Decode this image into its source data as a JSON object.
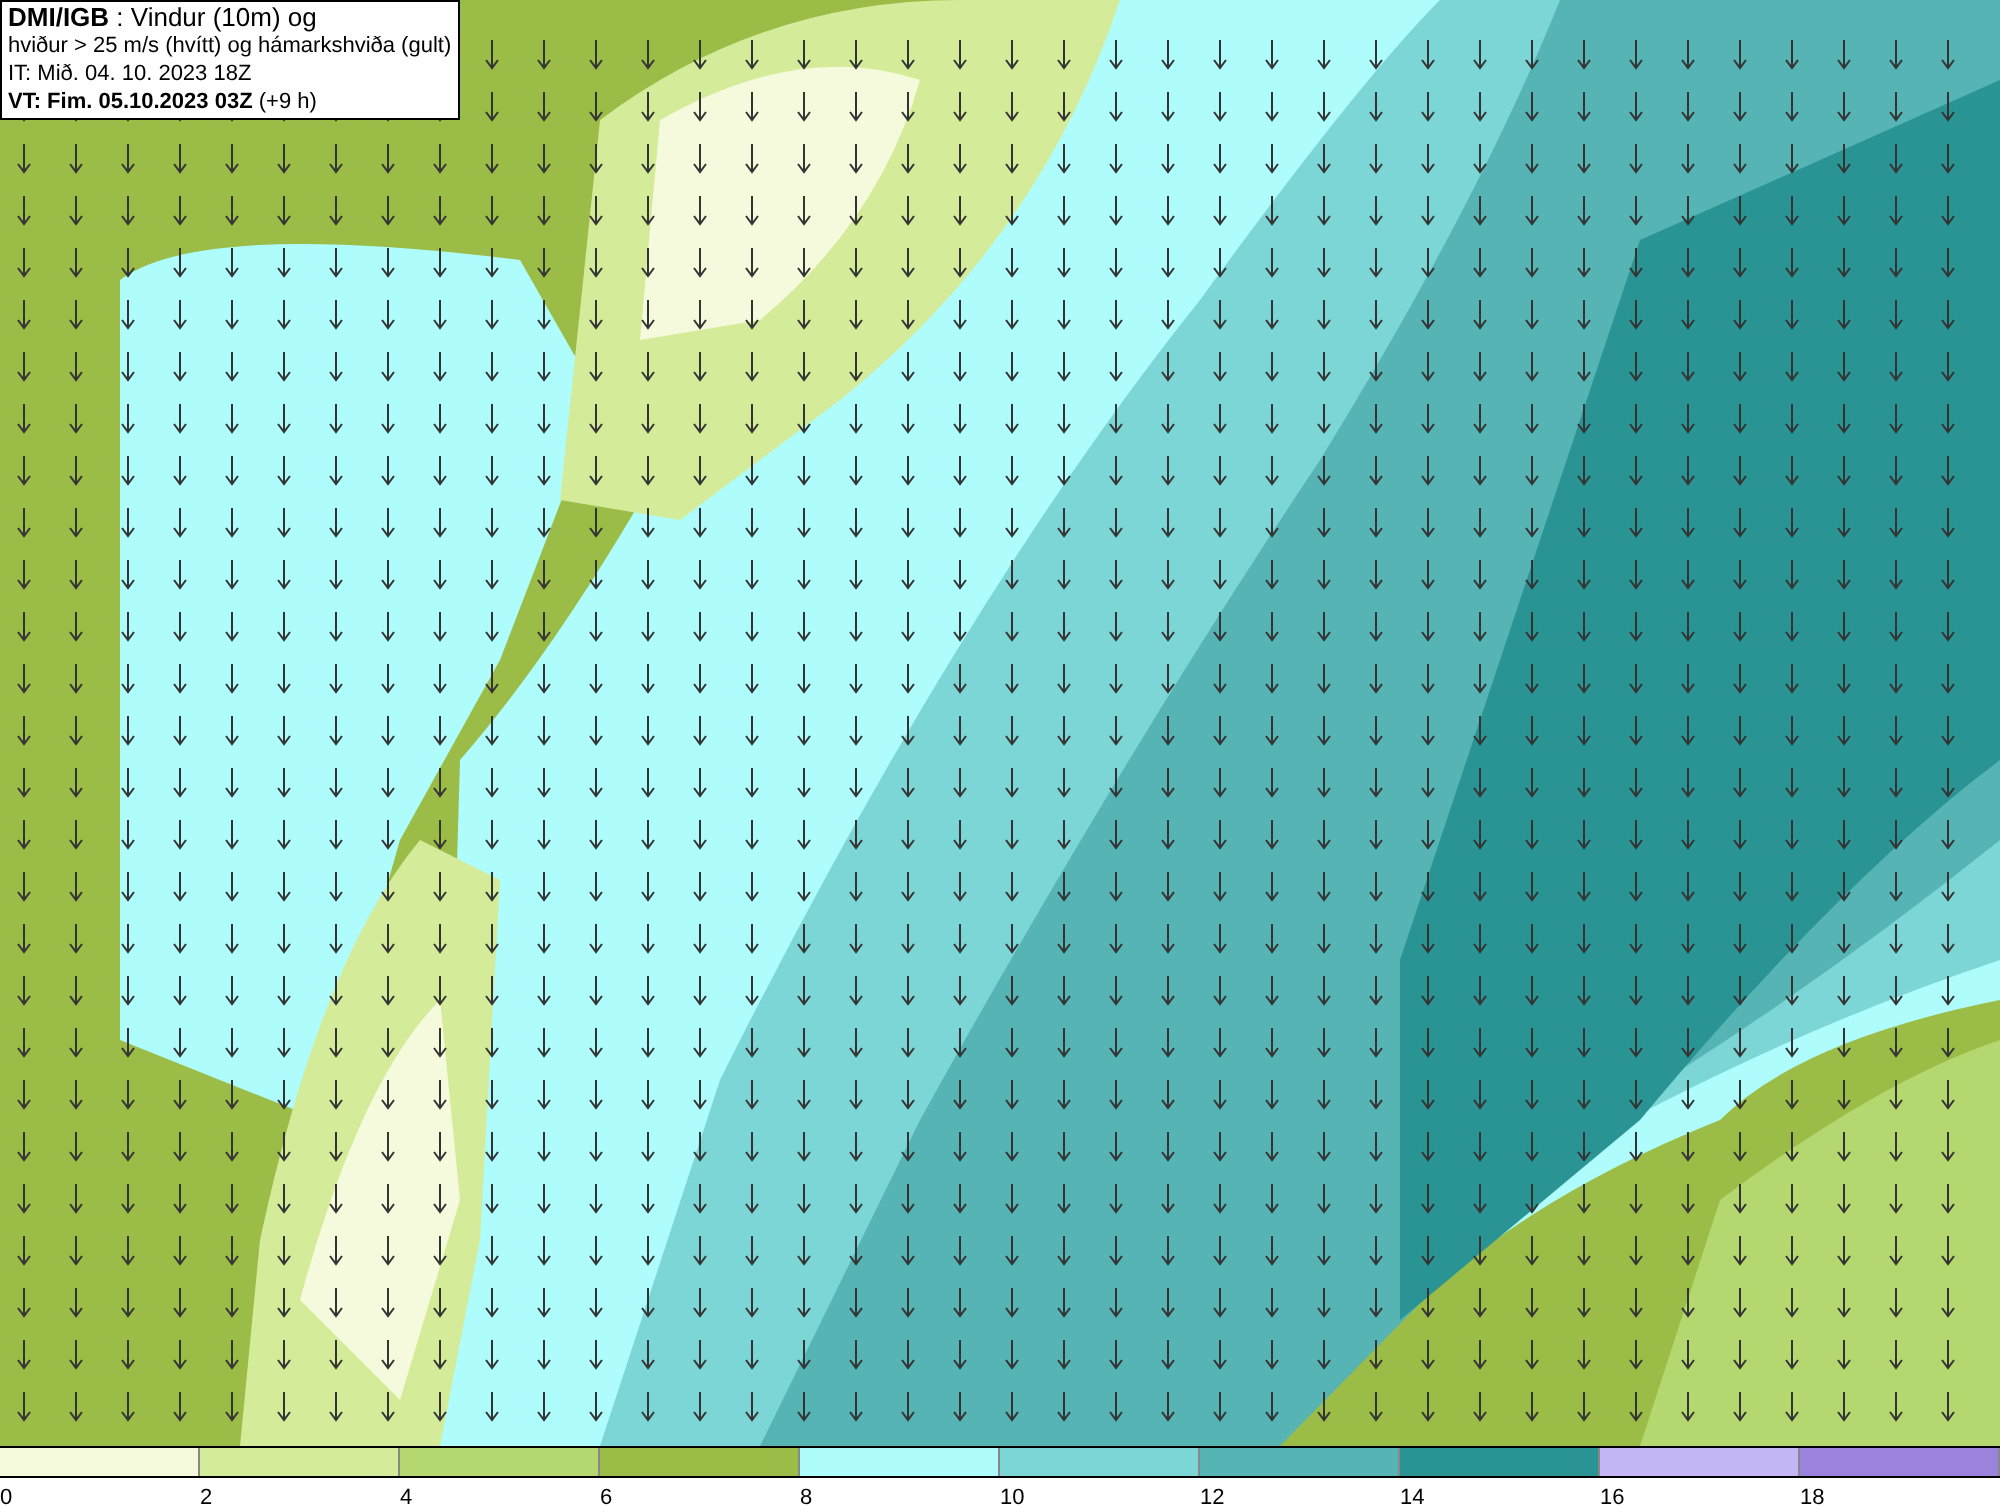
{
  "title_box": {
    "lines": [
      "**DMI/IGB** : Vindur (10m) og",
      "hviður > 25 m/s (hvítt) og hámarkshviða (gult)",
      "IT: Mið. 04. 10. 2023 18Z",
      "**VT: Fim. 05.10.2023 03Z** (+9 h)"
    ]
  },
  "legend": {
    "bins": [
      {
        "label": "0",
        "color": "#f5fadc"
      },
      {
        "label": "2",
        "color": "#d4ec9a"
      },
      {
        "label": "4",
        "color": "#b5d76f"
      },
      {
        "label": "6",
        "color": "#9bbc46"
      },
      {
        "label": "8",
        "color": "#aefcfc"
      },
      {
        "label": "10",
        "color": "#7dd6d6"
      },
      {
        "label": "12",
        "color": "#56b4b4"
      },
      {
        "label": "14",
        "color": "#2a9494"
      },
      {
        "label": "16",
        "color": "#c4b5f5"
      },
      {
        "label": "18",
        "color": "#9b82dc"
      }
    ]
  }
}
